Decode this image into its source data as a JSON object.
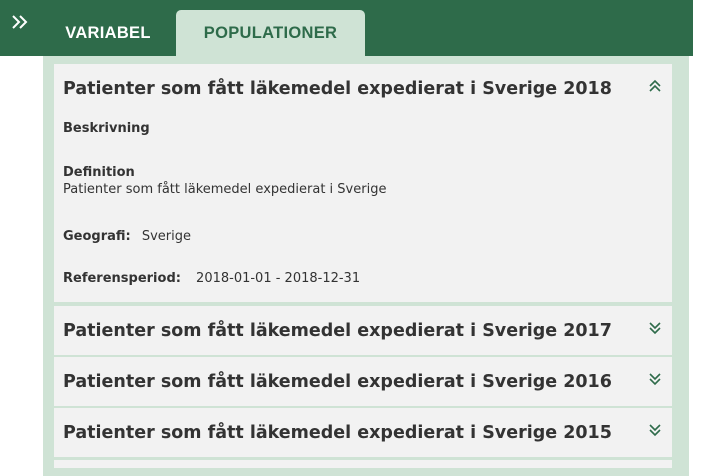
{
  "tabs": [
    {
      "label": "VARIABEL",
      "active": false
    },
    {
      "label": "POPULATIONER",
      "active": true
    }
  ],
  "populations": [
    {
      "title": "Patienter som fått läkemedel expedierat i Sverige 2018",
      "expanded": true,
      "beskrivning_label": "Beskrivning",
      "definition_label": "Definition",
      "definition_text": "Patienter som fått läkemedel expedierat i Sverige",
      "geografi_label": "Geografi:",
      "geografi_value": "Sverige",
      "referensperiod_label": "Referensperiod:",
      "referensperiod_value": "2018-01-01 - 2018-12-31"
    },
    {
      "title": "Patienter som fått läkemedel expedierat i Sverige 2017",
      "expanded": false
    },
    {
      "title": "Patienter som fått läkemedel expedierat i Sverige 2016",
      "expanded": false
    },
    {
      "title": "Patienter som fått läkemedel expedierat i Sverige 2015",
      "expanded": false
    }
  ],
  "icons": {
    "expand_panel": "double-chevron-right-icon",
    "collapse": "double-chevron-up-icon",
    "expand": "double-chevron-down-icon"
  },
  "colors": {
    "header_green": "#2e6b4a",
    "tab_active_bg": "#cfe3d5",
    "item_bg": "#f2f2f2",
    "text_dark": "#333333"
  }
}
